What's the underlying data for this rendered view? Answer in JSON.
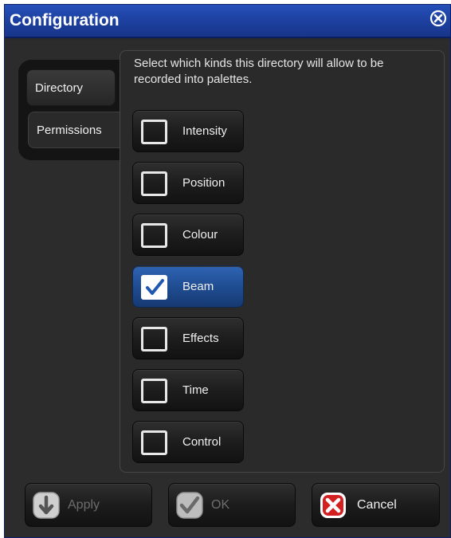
{
  "window": {
    "title": "Configuration",
    "close_icon": "close-circle-x"
  },
  "tabs": [
    {
      "label": "Directory",
      "selected": false
    },
    {
      "label": "Permissions",
      "selected": true
    }
  ],
  "panel": {
    "instruction": "Select which kinds this directory will allow to be recorded into palettes."
  },
  "kinds": [
    {
      "label": "Intensity",
      "checked": false
    },
    {
      "label": "Position",
      "checked": false
    },
    {
      "label": "Colour",
      "checked": false
    },
    {
      "label": "Beam",
      "checked": true
    },
    {
      "label": "Effects",
      "checked": false
    },
    {
      "label": "Time",
      "checked": false
    },
    {
      "label": "Control",
      "checked": false
    }
  ],
  "footer": {
    "apply_label": "Apply",
    "ok_label": "OK",
    "cancel_label": "Cancel"
  },
  "colors": {
    "titlebar": "#1c3f9e",
    "checked_button": "#1f4d92",
    "cancel_icon": "#d32020"
  }
}
